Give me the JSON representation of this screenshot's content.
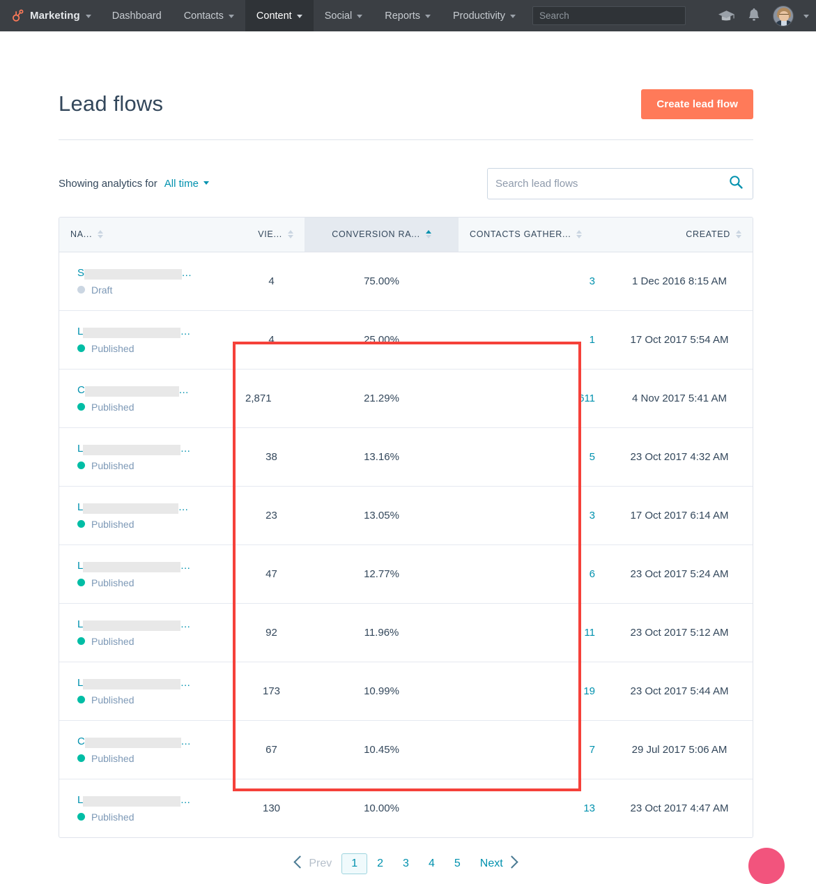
{
  "topnav": {
    "brand": {
      "label": "Marketing",
      "icon": "hubspot-sprocket-icon"
    },
    "items": [
      {
        "label": "Dashboard",
        "has_caret": false,
        "active": false
      },
      {
        "label": "Contacts",
        "has_caret": true,
        "active": false
      },
      {
        "label": "Content",
        "has_caret": true,
        "active": true
      },
      {
        "label": "Social",
        "has_caret": true,
        "active": false
      },
      {
        "label": "Reports",
        "has_caret": true,
        "active": false
      },
      {
        "label": "Productivity",
        "has_caret": true,
        "active": false
      }
    ],
    "search_placeholder": "Search",
    "search_value": "",
    "icons": [
      "academy-cap-icon",
      "notifications-bell-icon",
      "user-avatar"
    ]
  },
  "header": {
    "title": "Lead flows",
    "create_button": "Create lead flow"
  },
  "filters": {
    "label": "Showing analytics for",
    "range_value": "All time",
    "search_placeholder": "Search lead flows",
    "search_value": ""
  },
  "table": {
    "columns": [
      {
        "key": "name",
        "label": "NA...",
        "align": "left",
        "sorted": false
      },
      {
        "key": "views",
        "label": "VIE...",
        "align": "center",
        "sorted": false
      },
      {
        "key": "conversion",
        "label": "CONVERSION RA...",
        "align": "center",
        "sorted": true,
        "sort_dir": "asc"
      },
      {
        "key": "contacts",
        "label": "CONTACTS GATHER...",
        "align": "left",
        "sorted": false
      },
      {
        "key": "created",
        "label": "CREATED",
        "align": "right",
        "sorted": false
      }
    ],
    "rows": [
      {
        "name_first": "S",
        "name_redacted_width": 140,
        "status": "Draft",
        "views": "4",
        "conversion": "75.00%",
        "contacts": "3",
        "created": "1 Dec 2016 8:15 AM"
      },
      {
        "name_first": "L",
        "name_redacted_width": 140,
        "status": "Published",
        "views": "4",
        "conversion": "25.00%",
        "contacts": "1",
        "created": "17 Oct 2017 5:54 AM"
      },
      {
        "name_first": "C",
        "name_redacted_width": 135,
        "status": "Published",
        "views": "2,871",
        "conversion": "21.29%",
        "contacts": "611",
        "created": "4 Nov 2017 5:41 AM"
      },
      {
        "name_first": "L",
        "name_redacted_width": 140,
        "status": "Published",
        "views": "38",
        "conversion": "13.16%",
        "contacts": "5",
        "created": "23 Oct 2017 4:32 AM"
      },
      {
        "name_first": "L",
        "name_redacted_width": 137,
        "status": "Published",
        "views": "23",
        "conversion": "13.05%",
        "contacts": "3",
        "created": "17 Oct 2017 6:14 AM"
      },
      {
        "name_first": "L",
        "name_redacted_width": 140,
        "status": "Published",
        "views": "47",
        "conversion": "12.77%",
        "contacts": "6",
        "created": "23 Oct 2017 5:24 AM"
      },
      {
        "name_first": "L",
        "name_redacted_width": 140,
        "status": "Published",
        "views": "92",
        "conversion": "11.96%",
        "contacts": "11",
        "created": "23 Oct 2017 5:12 AM"
      },
      {
        "name_first": "L",
        "name_redacted_width": 140,
        "status": "Published",
        "views": "173",
        "conversion": "10.99%",
        "contacts": "19",
        "created": "23 Oct 2017 5:44 AM"
      },
      {
        "name_first": "C",
        "name_redacted_width": 138,
        "status": "Published",
        "views": "67",
        "conversion": "10.45%",
        "contacts": "7",
        "created": "29 Jul 2017 5:06 AM"
      },
      {
        "name_first": "L",
        "name_redacted_width": 140,
        "status": "Published",
        "views": "130",
        "conversion": "10.00%",
        "contacts": "13",
        "created": "23 Oct 2017 4:47 AM"
      }
    ],
    "name_ellipsis": "..."
  },
  "pagination": {
    "prev": "Prev",
    "next": "Next",
    "pages": [
      "1",
      "2",
      "3",
      "4",
      "5"
    ],
    "current": "1"
  },
  "annotation": {
    "type": "red-rectangle-highlight",
    "color": "#f5413a",
    "covers_columns": [
      "VIE...",
      "CONVERSION RA...",
      "CONTACTS GATHER..."
    ],
    "covers_rows_from": 3,
    "covers_rows_to": 10
  },
  "colors": {
    "brand_orange": "#ff7a59",
    "accent_teal": "#0091ae",
    "status_published": "#00bda5",
    "status_draft": "#cbd6e2",
    "text_dark": "#33475b",
    "nav_bg": "#3b3f44",
    "annotation_red": "#f5413a",
    "chat_pink": "#f2547d"
  }
}
